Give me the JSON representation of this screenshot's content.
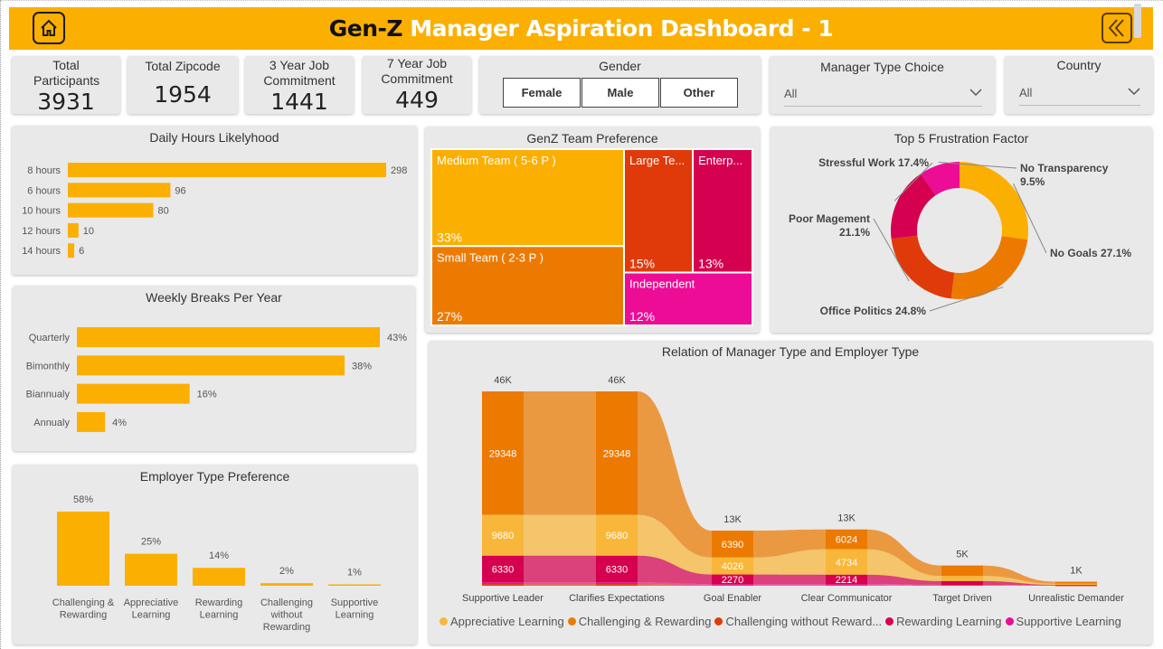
{
  "header": {
    "title_part1": "Gen-Z",
    "title_part2": "Manager Aspiration Dashboard - 1",
    "home_icon": "home-icon",
    "back_icon": "double-chevron-left-icon",
    "accent_color": "#fbaf00"
  },
  "kpis": [
    {
      "label": "Total Participants",
      "value": "3931"
    },
    {
      "label": "Total Zipcode",
      "value": "1954"
    },
    {
      "label": "3 Year Job Commitment",
      "value": "1441"
    },
    {
      "label": "7 Year Job Commitment",
      "value": "449"
    }
  ],
  "gender_slicer": {
    "title": "Gender",
    "options": [
      "Female",
      "Male",
      "Other"
    ]
  },
  "manager_type_slicer": {
    "title": "Manager Type Choice",
    "selected": "All"
  },
  "country_slicer": {
    "title": "Country",
    "selected": "All"
  },
  "colors": {
    "orange": "#fbaf00",
    "dark_orange": "#ec7a00",
    "red": "#e03a0b",
    "crimson": "#d5004f",
    "pink": "#ec0c96",
    "light_orange": "#f8b73a"
  },
  "chart_data": [
    {
      "id": "daily_hours",
      "type": "bar",
      "orientation": "horizontal",
      "title": "Daily Hours Likelyhood",
      "categories": [
        "8 hours",
        "6 hours",
        "10 hours",
        "12 hours",
        "14 hours"
      ],
      "values": [
        298,
        96,
        80,
        10,
        6
      ],
      "labels": [
        "298",
        "96",
        "80",
        "10",
        "6"
      ]
    },
    {
      "id": "weekly_breaks",
      "type": "bar",
      "orientation": "horizontal",
      "title": "Weekly Breaks Per Year",
      "categories": [
        "Quarterly",
        "Bimonthly",
        "Biannualy",
        "Annualy"
      ],
      "values": [
        43,
        38,
        16,
        4
      ],
      "labels": [
        "43%",
        "38%",
        "16%",
        "4%"
      ]
    },
    {
      "id": "employer_pref",
      "type": "bar",
      "orientation": "vertical",
      "title": "Employer Type Preference",
      "categories": [
        "Challenging & Rewarding",
        "Appreciative Learning",
        "Rewarding Learning",
        "Challenging without Rewarding",
        "Supportive Learning"
      ],
      "category_lines": [
        [
          "Challenging &",
          "Rewarding"
        ],
        [
          "Appreciative",
          "Learning"
        ],
        [
          "Rewarding",
          "Learning"
        ],
        [
          "Challenging",
          "without",
          "Rewarding"
        ],
        [
          "Supportive",
          "Learning"
        ]
      ],
      "values": [
        58,
        25,
        14,
        2,
        1
      ],
      "labels": [
        "58%",
        "25%",
        "14%",
        "2%",
        "1%"
      ]
    },
    {
      "id": "team_pref",
      "type": "treemap",
      "title": "GenZ Team Preference",
      "items": [
        {
          "label": "Medium Team ( 5-6 P )",
          "value": 33,
          "pct": "33%"
        },
        {
          "label": "Small Team ( 2-3 P )",
          "value": 27,
          "pct": "27%"
        },
        {
          "label": "Large Te...",
          "value": 15,
          "pct": "15%"
        },
        {
          "label": "Enterp...",
          "value": 13,
          "pct": "13%"
        },
        {
          "label": "Independent",
          "value": 12,
          "pct": "12%"
        }
      ]
    },
    {
      "id": "frustration",
      "type": "pie",
      "title": "Top 5 Frustration Factor",
      "slices": [
        {
          "label": "No Goals",
          "value": 27.1,
          "text": "No Goals 27.1%"
        },
        {
          "label": "Office Politics",
          "value": 24.8,
          "text": "Office Politics 24.8%"
        },
        {
          "label": "Poor Magement",
          "value": 21.1,
          "text_lines": [
            "Poor Magement",
            "21.1%"
          ]
        },
        {
          "label": "Stressful Work",
          "value": 17.4,
          "text": "Stressful Work 17.4%"
        },
        {
          "label": "No Transparency",
          "value": 9.5,
          "text_lines": [
            "No Transparency",
            "9.5%"
          ]
        }
      ]
    },
    {
      "id": "manager_employer",
      "type": "area",
      "subtype": "ribbon",
      "title": "Relation of Manager Type and Employer Type",
      "categories": [
        "Supportive Leader",
        "Clarifies Expectations",
        "Goal Enabler",
        "Clear Communicator",
        "Target Driven",
        "Unrealistic Demander"
      ],
      "totals": [
        "46K",
        "46K",
        "13K",
        "13K",
        "5K",
        "1K"
      ],
      "series": [
        {
          "name": "Appreciative Learning",
          "values": [
            9680,
            9680,
            4026,
            6024,
            1200,
            250
          ]
        },
        {
          "name": "Challenging & Rewarding",
          "values": [
            29348,
            29348,
            6390,
            4734,
            2500,
            500
          ]
        },
        {
          "name": "Challenging without Reward...",
          "values": [
            400,
            400,
            200,
            200,
            100,
            30
          ]
        },
        {
          "name": "Rewarding Learning",
          "values": [
            6330,
            6330,
            2270,
            2214,
            900,
            150
          ]
        },
        {
          "name": "Supportive Learning",
          "values": [
            400,
            400,
            200,
            200,
            100,
            30
          ]
        }
      ],
      "point_labels": [
        [
          "29348",
          "9680",
          "6330"
        ],
        [
          "29348",
          "9680",
          "6330"
        ],
        [
          "6390",
          "4026",
          "2270"
        ],
        [
          "6024",
          "4734",
          "2214"
        ],
        [],
        []
      ]
    }
  ]
}
